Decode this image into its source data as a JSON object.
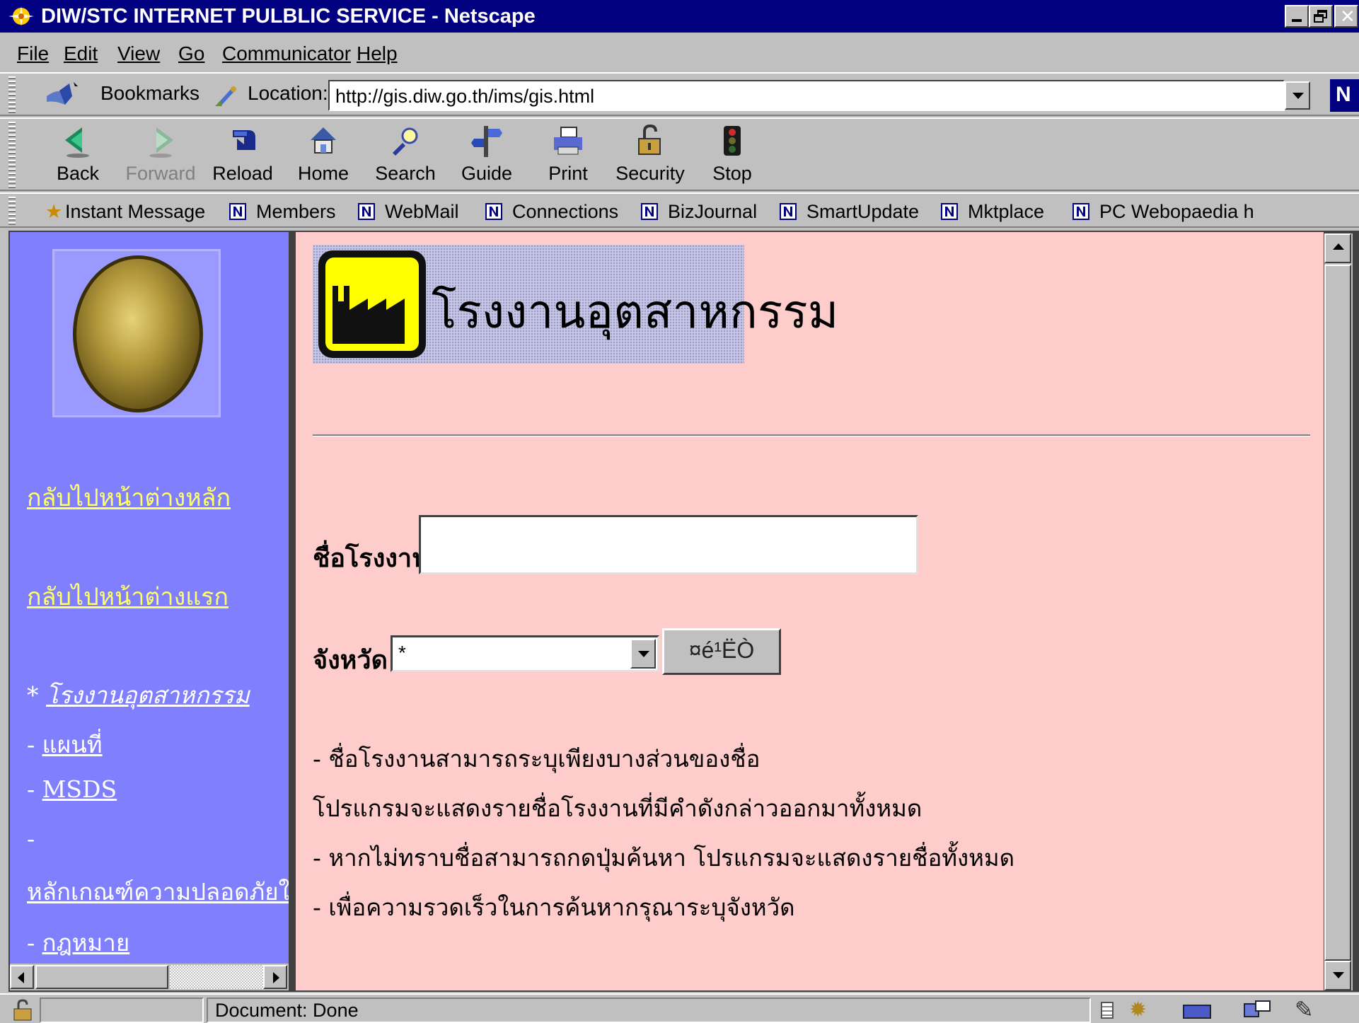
{
  "window": {
    "title": "DIW/STC INTERNET PULBLIC SERVICE - Netscape"
  },
  "menu": [
    "File",
    "Edit",
    "View",
    "Go",
    "Communicator",
    "Help"
  ],
  "locationbar": {
    "bookmarks_label": "Bookmarks",
    "location_label": "Location:",
    "url": "http://gis.diw.go.th/ims/gis.html"
  },
  "navbar": {
    "buttons": [
      "Back",
      "Forward",
      "Reload",
      "Home",
      "Search",
      "Guide",
      "Print",
      "Security",
      "Stop"
    ]
  },
  "personalbar": {
    "items": [
      "Instant Message",
      "Members",
      "WebMail",
      "Connections",
      "BizJournal",
      "SmartUpdate",
      "Mktplace",
      "PC Webopaedia h"
    ]
  },
  "sidebar": {
    "link_main": "กลับไปหน้าต่างหลัก",
    "link_first": "กลับไปหน้าต่างแรก",
    "items": [
      {
        "prefix": "* ",
        "label": "โรงงานอุตสาหกรรม"
      },
      {
        "prefix": "- ",
        "label": "แผนที่"
      },
      {
        "prefix": "- ",
        "label": "MSDS"
      },
      {
        "prefix": "-",
        "label": ""
      },
      {
        "prefix": "",
        "label": "หลักเกณฑ์ความปลอดภัยใน"
      },
      {
        "prefix": "- ",
        "label": "กฎหมาย"
      }
    ]
  },
  "main": {
    "banner_title": "โรงงานอุตสาหกรรม",
    "factory_label": "ชื่อโรงงาน",
    "factory_value": "",
    "province_label": "จังหวัด",
    "province_value": "*",
    "search_button": "¤é¹ËÒ",
    "notes": [
      "- ชื่อโรงงานสามารถระบุเพียงบางส่วนของชื่อ",
      "โปรแกรมจะแสดงรายชื่อโรงงานที่มีคำดังกล่าวออกมาทั้งหมด",
      "- หากไม่ทราบชื่อสามารถกดปุ่มค้นหา โปรแกรมจะแสดงรายชื่อทั้งหมด",
      "- เพื่อความรวดเร็วในการค้นหากรุณาระบุจังหวัด"
    ]
  },
  "status": {
    "text": "Document: Done"
  }
}
